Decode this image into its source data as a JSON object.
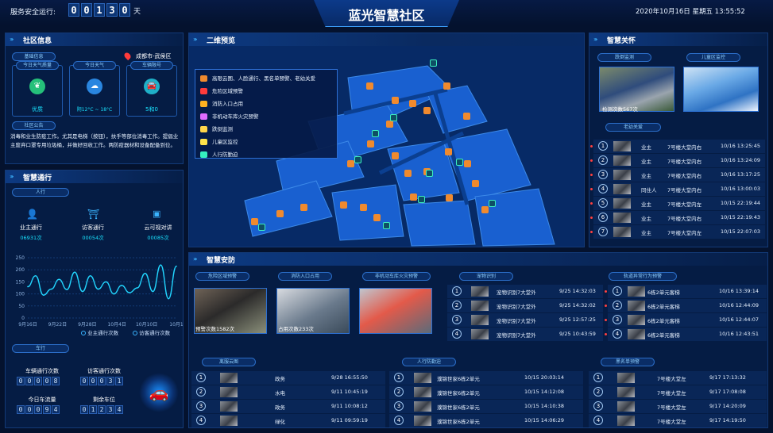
{
  "header": {
    "title": "蓝光智慧社区",
    "uptime_label": "服务安全运行:",
    "uptime_digits": [
      "0",
      "0",
      "1",
      "3",
      "0"
    ],
    "uptime_unit": "天",
    "datetime": "2020年10月16日 星期五 13:55:52"
  },
  "community": {
    "title": "社区信息",
    "basic_label": "基础信息",
    "location": "成都市-武侯区",
    "cards": [
      {
        "label": "今日天气质量",
        "value": "优质",
        "icon": "leaf-icon"
      },
      {
        "label": "今日天气",
        "value": "阴12°C ~ 18°C",
        "icon": "cloud-icon"
      },
      {
        "label": "车辆限号",
        "value": "5和0",
        "icon": "car-icon"
      }
    ],
    "notice_label": "社区公告",
    "notice_text": "消毒和业生防疫工作。尤其是电梯（按钮），扶手等部位消毒工作。提倡业主废弃口罩专用垃圾桶，并做好回收工作。两防疫器材和设备配备到位。"
  },
  "traffic": {
    "title": "智慧通行",
    "people_label": "人行",
    "stats": [
      {
        "label": "业主通行",
        "value": "06931次",
        "icon": "person-icon"
      },
      {
        "label": "访客通行",
        "value": "00054次",
        "icon": "gate-icon"
      },
      {
        "label": "云可视对讲",
        "value": "00085次",
        "icon": "intercom-icon"
      }
    ],
    "chart": {
      "yticks": [
        "250",
        "200",
        "150",
        "100",
        "50",
        "0"
      ],
      "xticks": [
        "9月16日",
        "9月22日",
        "9月28日",
        "10月4日",
        "10月10日",
        "10月1"
      ],
      "legend": [
        "业主通行次数",
        "访客通行次数"
      ]
    },
    "car_label": "车行",
    "counters": [
      {
        "label": "车辆通行次数",
        "digits": [
          "0",
          "0",
          "0",
          "0",
          "8"
        ]
      },
      {
        "label": "访客通行次数",
        "digits": [
          "0",
          "0",
          "0",
          "3",
          "1"
        ]
      },
      {
        "label": "今日车流量",
        "digits": [
          "0",
          "0",
          "0",
          "9",
          "4"
        ]
      },
      {
        "label": "剩余车位",
        "digits": [
          "0",
          "1",
          "2",
          "3",
          "4"
        ]
      }
    ]
  },
  "chart_data": {
    "type": "line",
    "x": [
      "9月16日",
      "9月22日",
      "9月28日",
      "10月4日",
      "10月10日",
      "10月1"
    ],
    "series": [
      {
        "name": "业主通行次数",
        "values": [
          130,
          175,
          95,
          120,
          160,
          118,
          190,
          110,
          175,
          120,
          150,
          100,
          135,
          105,
          125,
          185,
          110,
          220,
          80,
          215
        ]
      }
    ],
    "ylim": [
      0,
      250
    ]
  },
  "map": {
    "title": "二维预览",
    "legend": [
      {
        "label": "高限云图、人脸通行、黑名单预警、老幼关爱",
        "color": "#f08a2e"
      },
      {
        "label": "危险区域预警",
        "color": "#ff3b3b"
      },
      {
        "label": "消防入口占用",
        "color": "#ffb020"
      },
      {
        "label": "非机动车库火灾预警",
        "color": "#e06cff"
      },
      {
        "label": "跌倒监测",
        "color": "#ffd54a"
      },
      {
        "label": "儿童区监控",
        "color": "#ffe34a"
      },
      {
        "label": "人行防勤迫",
        "color": "#35f0c0"
      }
    ]
  },
  "care": {
    "title": "智慧关怀",
    "fall_label": "跌倒监测",
    "kids_label": "儿童区监控",
    "fall_count": "检测次数567次",
    "elder_label": "老幼关爱",
    "rows": [
      {
        "n": "1",
        "who": "业主",
        "loc": "7号楼大堂内右",
        "time": "10/16 13:25:45"
      },
      {
        "n": "2",
        "who": "业主",
        "loc": "7号楼大堂内右",
        "time": "10/16 13:24:09"
      },
      {
        "n": "3",
        "who": "业主",
        "loc": "7号楼大堂内右",
        "time": "10/16 13:17:25"
      },
      {
        "n": "4",
        "who": "同住人",
        "loc": "7号楼大堂内右",
        "time": "10/16 13:00:03"
      },
      {
        "n": "5",
        "who": "业主",
        "loc": "7号楼大堂内左",
        "time": "10/15 22:19:44"
      },
      {
        "n": "6",
        "who": "业主",
        "loc": "7号楼大堂内右",
        "time": "10/15 22:19:43"
      },
      {
        "n": "7",
        "who": "业主",
        "loc": "7号楼大堂内左",
        "time": "10/15 22:07:03"
      }
    ]
  },
  "security": {
    "title": "智慧安防",
    "cams": [
      {
        "label": "危险区域预警",
        "caption": "预警次数1582次"
      },
      {
        "label": "消防入口占用",
        "caption": "占用次数233次"
      },
      {
        "label": "非机动车库火灾预警",
        "caption": ""
      }
    ],
    "pet_label": "宠物识别",
    "pet_rows": [
      {
        "n": "1",
        "loc": "宠物识别7大堂外",
        "time": "9/25 14:32:03"
      },
      {
        "n": "2",
        "loc": "宠物识别7大堂外",
        "time": "9/25 14:32:02"
      },
      {
        "n": "3",
        "loc": "宠物识别7大堂外",
        "time": "9/25 12:57:25"
      },
      {
        "n": "4",
        "loc": "宠物识别7大堂外",
        "time": "9/25 10:43:59"
      }
    ],
    "abn_label": "轨道异常行为预警",
    "abn_rows": [
      {
        "n": "1",
        "loc": "6栋2单元客梯",
        "time": "10/16 13:39:14"
      },
      {
        "n": "2",
        "loc": "6栋2单元客梯",
        "time": "10/16 12:44:09"
      },
      {
        "n": "3",
        "loc": "6栋2单元客梯",
        "time": "10/16 12:44:07"
      },
      {
        "n": "4",
        "loc": "6栋2单元客梯",
        "time": "10/16 12:43:51"
      }
    ],
    "face_label": "离服云图",
    "face_rows": [
      {
        "n": "1",
        "dept": "政务",
        "time": "9/28 16:55:50"
      },
      {
        "n": "2",
        "dept": "水电",
        "time": "9/11 10:45:19"
      },
      {
        "n": "3",
        "dept": "政务",
        "time": "9/11 10:08:12"
      },
      {
        "n": "4",
        "dept": "绿化",
        "time": "9/11 09:59:19"
      }
    ],
    "walk_label": "人行防勤迫",
    "walk_rows": [
      {
        "n": "1",
        "loc": "濮锦世家6栋2单元",
        "time": "10/15 20:03:14"
      },
      {
        "n": "2",
        "loc": "濮锦世家6栋2单元",
        "time": "10/15 14:12:08"
      },
      {
        "n": "3",
        "loc": "濮锦世家6栋2单元",
        "time": "10/15 14:10:38"
      },
      {
        "n": "4",
        "loc": "濮锦世家6栋2单元",
        "time": "10/15 14:06:29"
      }
    ],
    "black_label": "黑名单预警",
    "black_rows": [
      {
        "n": "1",
        "loc": "7号楼大堂左",
        "time": "9/17 17:13:32"
      },
      {
        "n": "2",
        "loc": "7号楼大堂左",
        "time": "9/17 17:08:08"
      },
      {
        "n": "3",
        "loc": "7号楼大堂左",
        "time": "9/17 14:20:09"
      },
      {
        "n": "4",
        "loc": "7号楼大堂左",
        "time": "9/17 14:19:50"
      }
    ]
  }
}
